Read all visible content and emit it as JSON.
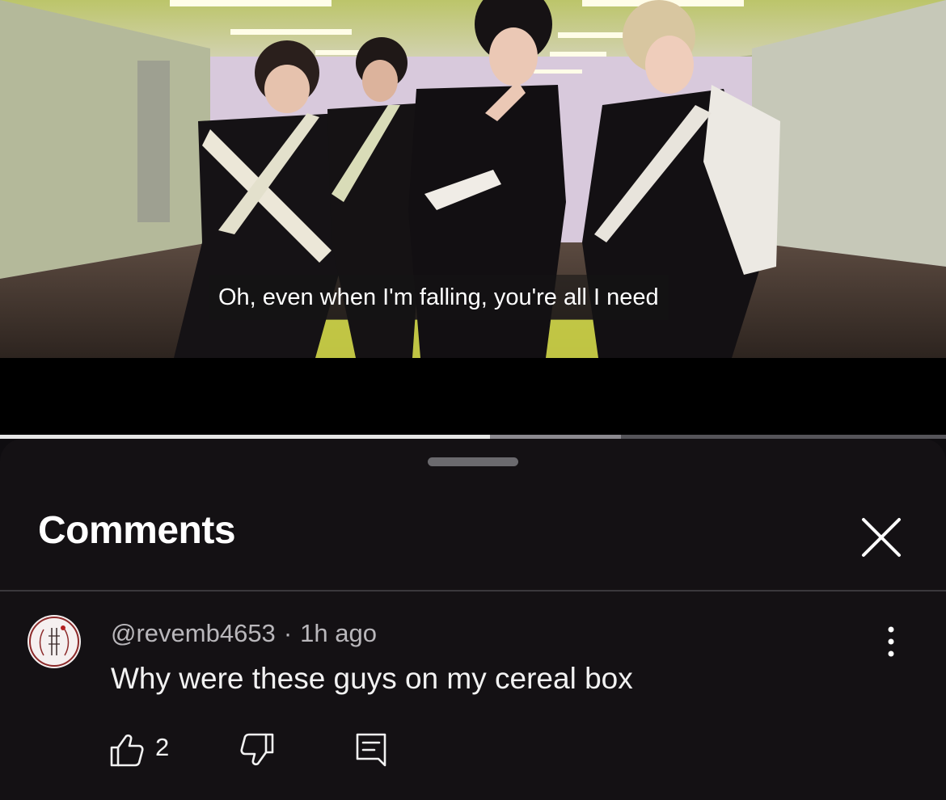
{
  "video": {
    "subtitle": "Oh, even when I'm falling, you're all I need",
    "progress_played": 0.518,
    "progress_buffered": 0.656
  },
  "comments_panel": {
    "title": "Comments",
    "close_icon": "close-icon"
  },
  "comments": [
    {
      "author": "@revemb4653",
      "separator": "·",
      "time": "1h ago",
      "text": "Why were these guys on my cereal box",
      "like_count": "2",
      "icons": [
        "thumb-up-icon",
        "thumb-down-icon",
        "reply-icon",
        "more-vert-icon"
      ]
    }
  ],
  "colors": {
    "sheet_background": "#141114",
    "text_primary": "#f2f2f2",
    "text_secondary": "#b9b7bb",
    "progress_played": "#e6e6e6"
  }
}
